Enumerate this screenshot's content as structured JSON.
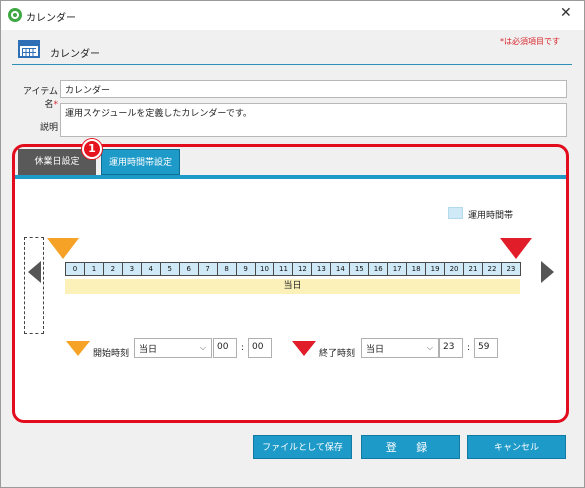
{
  "window": {
    "title": "カレンダー",
    "close_glyph": "✕"
  },
  "header": {
    "title": "カレンダー",
    "required_note": "*は必須項目です"
  },
  "form": {
    "item_name_label": "アイテム名",
    "required_mark": "*",
    "item_name_value": "カレンダー",
    "description_label": "説明",
    "description_value": "運用スケジュールを定義したカレンダーです。"
  },
  "annotation": {
    "badge": "1"
  },
  "tabs": [
    {
      "label": "休業日設定",
      "active": false
    },
    {
      "label": "運用時間帯設定",
      "active": true
    }
  ],
  "legend": {
    "label": "運用時間帯"
  },
  "hours": [
    "0",
    "1",
    "2",
    "3",
    "4",
    "5",
    "6",
    "7",
    "8",
    "9",
    "10",
    "11",
    "12",
    "13",
    "14",
    "15",
    "16",
    "17",
    "18",
    "19",
    "20",
    "21",
    "22",
    "23"
  ],
  "day_bar": {
    "label": "当日"
  },
  "start": {
    "label": "開始時刻",
    "day": "当日",
    "hour": "00",
    "minute": "00"
  },
  "end": {
    "label": "終了時刻",
    "day": "当日",
    "hour": "23",
    "minute": "59"
  },
  "time_separator": ":",
  "buttons": {
    "save_file": "ファイルとして保存",
    "register": "登 録",
    "cancel": "キャンセル"
  },
  "icons": {
    "app": "circular-arrows-icon",
    "calendar": "calendar-icon",
    "chevron": "chevron-down-icon"
  },
  "colors": {
    "accent": "#1e9ac9",
    "start_marker": "#f5a227",
    "end_marker": "#e11d2a",
    "annotation": "#e20c1d",
    "hour_fill": "#cfe9f7",
    "day_fill": "#fbf1b9"
  }
}
